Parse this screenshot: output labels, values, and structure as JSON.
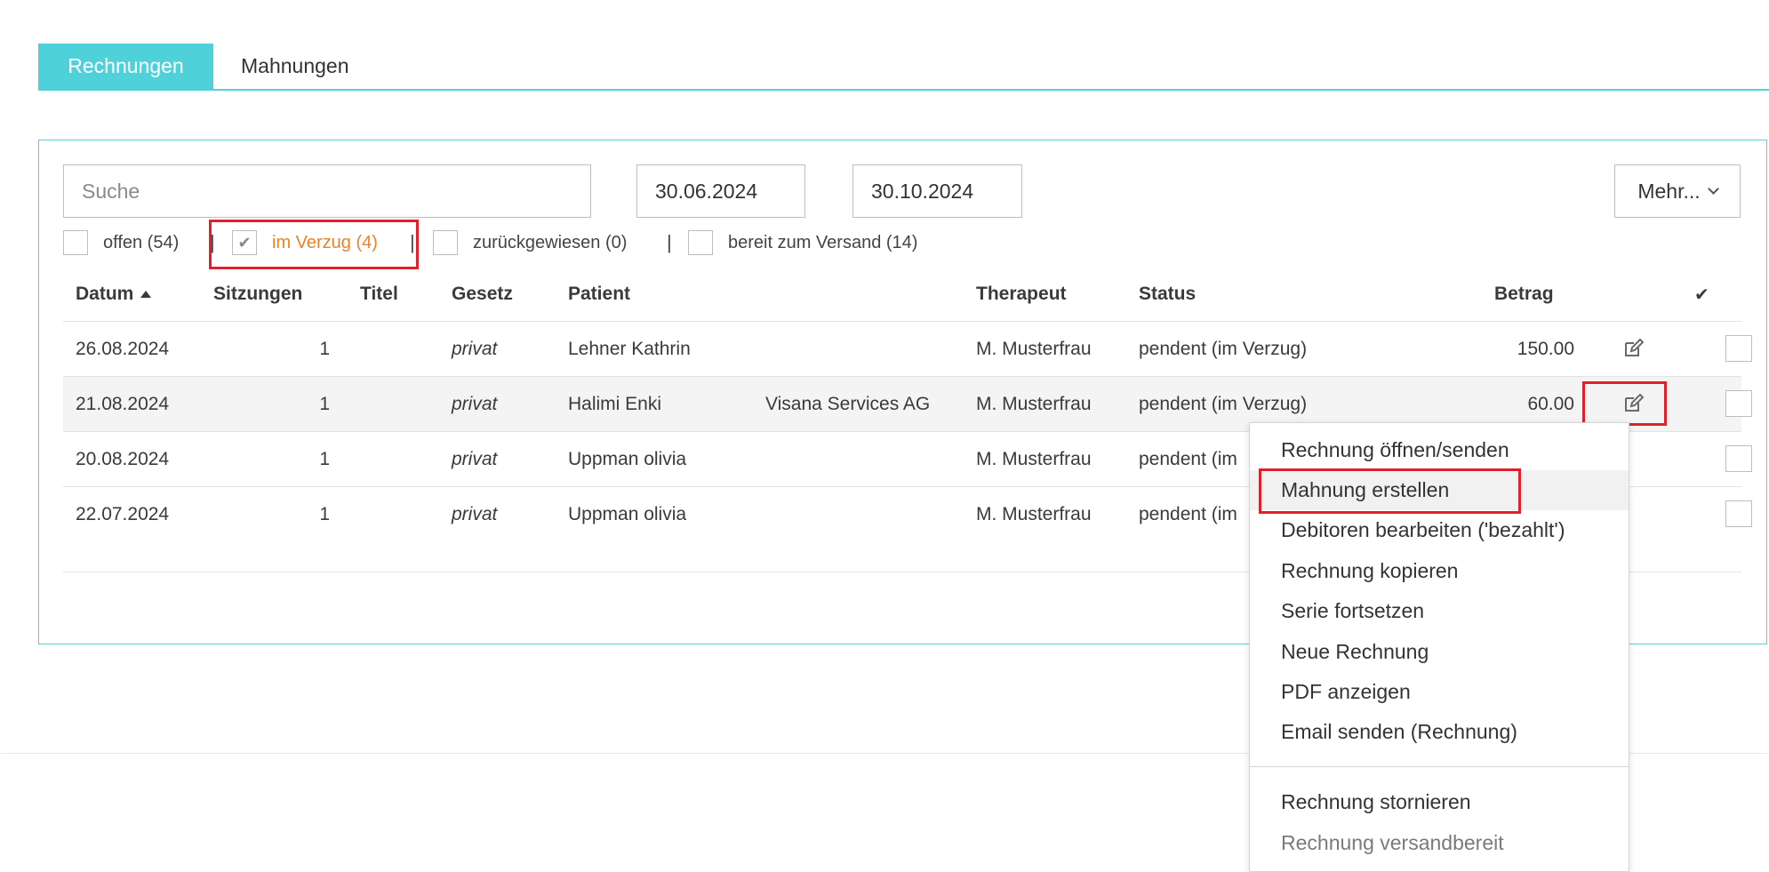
{
  "tabs": [
    {
      "label": "Rechnungen",
      "active": true
    },
    {
      "label": "Mahnungen",
      "active": false
    }
  ],
  "filters": {
    "search_placeholder": "Suche",
    "date_from": "30.06.2024",
    "date_to": "30.10.2024",
    "more_label": "Mehr...",
    "checkboxes": [
      {
        "label": "offen (54)",
        "checked": false
      },
      {
        "label": "im Verzug (4)",
        "checked": true
      },
      {
        "label": "zurückgewiesen (0)",
        "checked": false
      },
      {
        "label": "bereit zum Versand (14)",
        "checked": false
      }
    ],
    "separator": "|"
  },
  "table": {
    "columns": {
      "datum": "Datum",
      "sitzungen": "Sitzungen",
      "titel": "Titel",
      "gesetz": "Gesetz",
      "patient": "Patient",
      "therapeut": "Therapeut",
      "status": "Status",
      "betrag": "Betrag",
      "check": "✔"
    },
    "rows": [
      {
        "datum": "26.08.2024",
        "sitzungen": "1",
        "titel": "",
        "gesetz": "privat",
        "patient": "Lehner Kathrin",
        "versicherer": "",
        "therapeut": "M. Musterfrau",
        "status": "pendent (im Verzug)",
        "betrag": "150.00"
      },
      {
        "datum": "21.08.2024",
        "sitzungen": "1",
        "titel": "",
        "gesetz": "privat",
        "patient": "Halimi Enki",
        "versicherer": "Visana Services AG",
        "therapeut": "M. Musterfrau",
        "status": "pendent (im Verzug)",
        "betrag": "60.00"
      },
      {
        "datum": "20.08.2024",
        "sitzungen": "1",
        "titel": "",
        "gesetz": "privat",
        "patient": "Uppman olivia",
        "versicherer": "",
        "therapeut": "M. Musterfrau",
        "status": "pendent (im",
        "betrag": ""
      },
      {
        "datum": "22.07.2024",
        "sitzungen": "1",
        "titel": "",
        "gesetz": "privat",
        "patient": "Uppman olivia",
        "versicherer": "",
        "therapeut": "M. Musterfrau",
        "status": "pendent (im",
        "betrag": ""
      }
    ]
  },
  "menu": {
    "items": [
      {
        "label": "Rechnung öffnen/senden"
      },
      {
        "label": "Mahnung erstellen"
      },
      {
        "label": "Debitoren bearbeiten ('bezahlt')"
      },
      {
        "label": "Rechnung kopieren"
      },
      {
        "label": "Serie fortsetzen"
      },
      {
        "label": "Neue Rechnung"
      },
      {
        "label": "PDF anzeigen"
      },
      {
        "label": "Email senden (Rechnung)"
      },
      {
        "label": "Rechnung stornieren"
      },
      {
        "label": "Rechnung versandbereit"
      }
    ]
  },
  "colors": {
    "accent": "#4fd1da",
    "status_orange": "#e8832a",
    "highlight_red": "#e0202b"
  },
  "icons": {
    "sort": "sort-ascending-icon",
    "edit": "edit-icon",
    "check": "checkmark-icon",
    "dropdown": "chevron-down-icon"
  }
}
